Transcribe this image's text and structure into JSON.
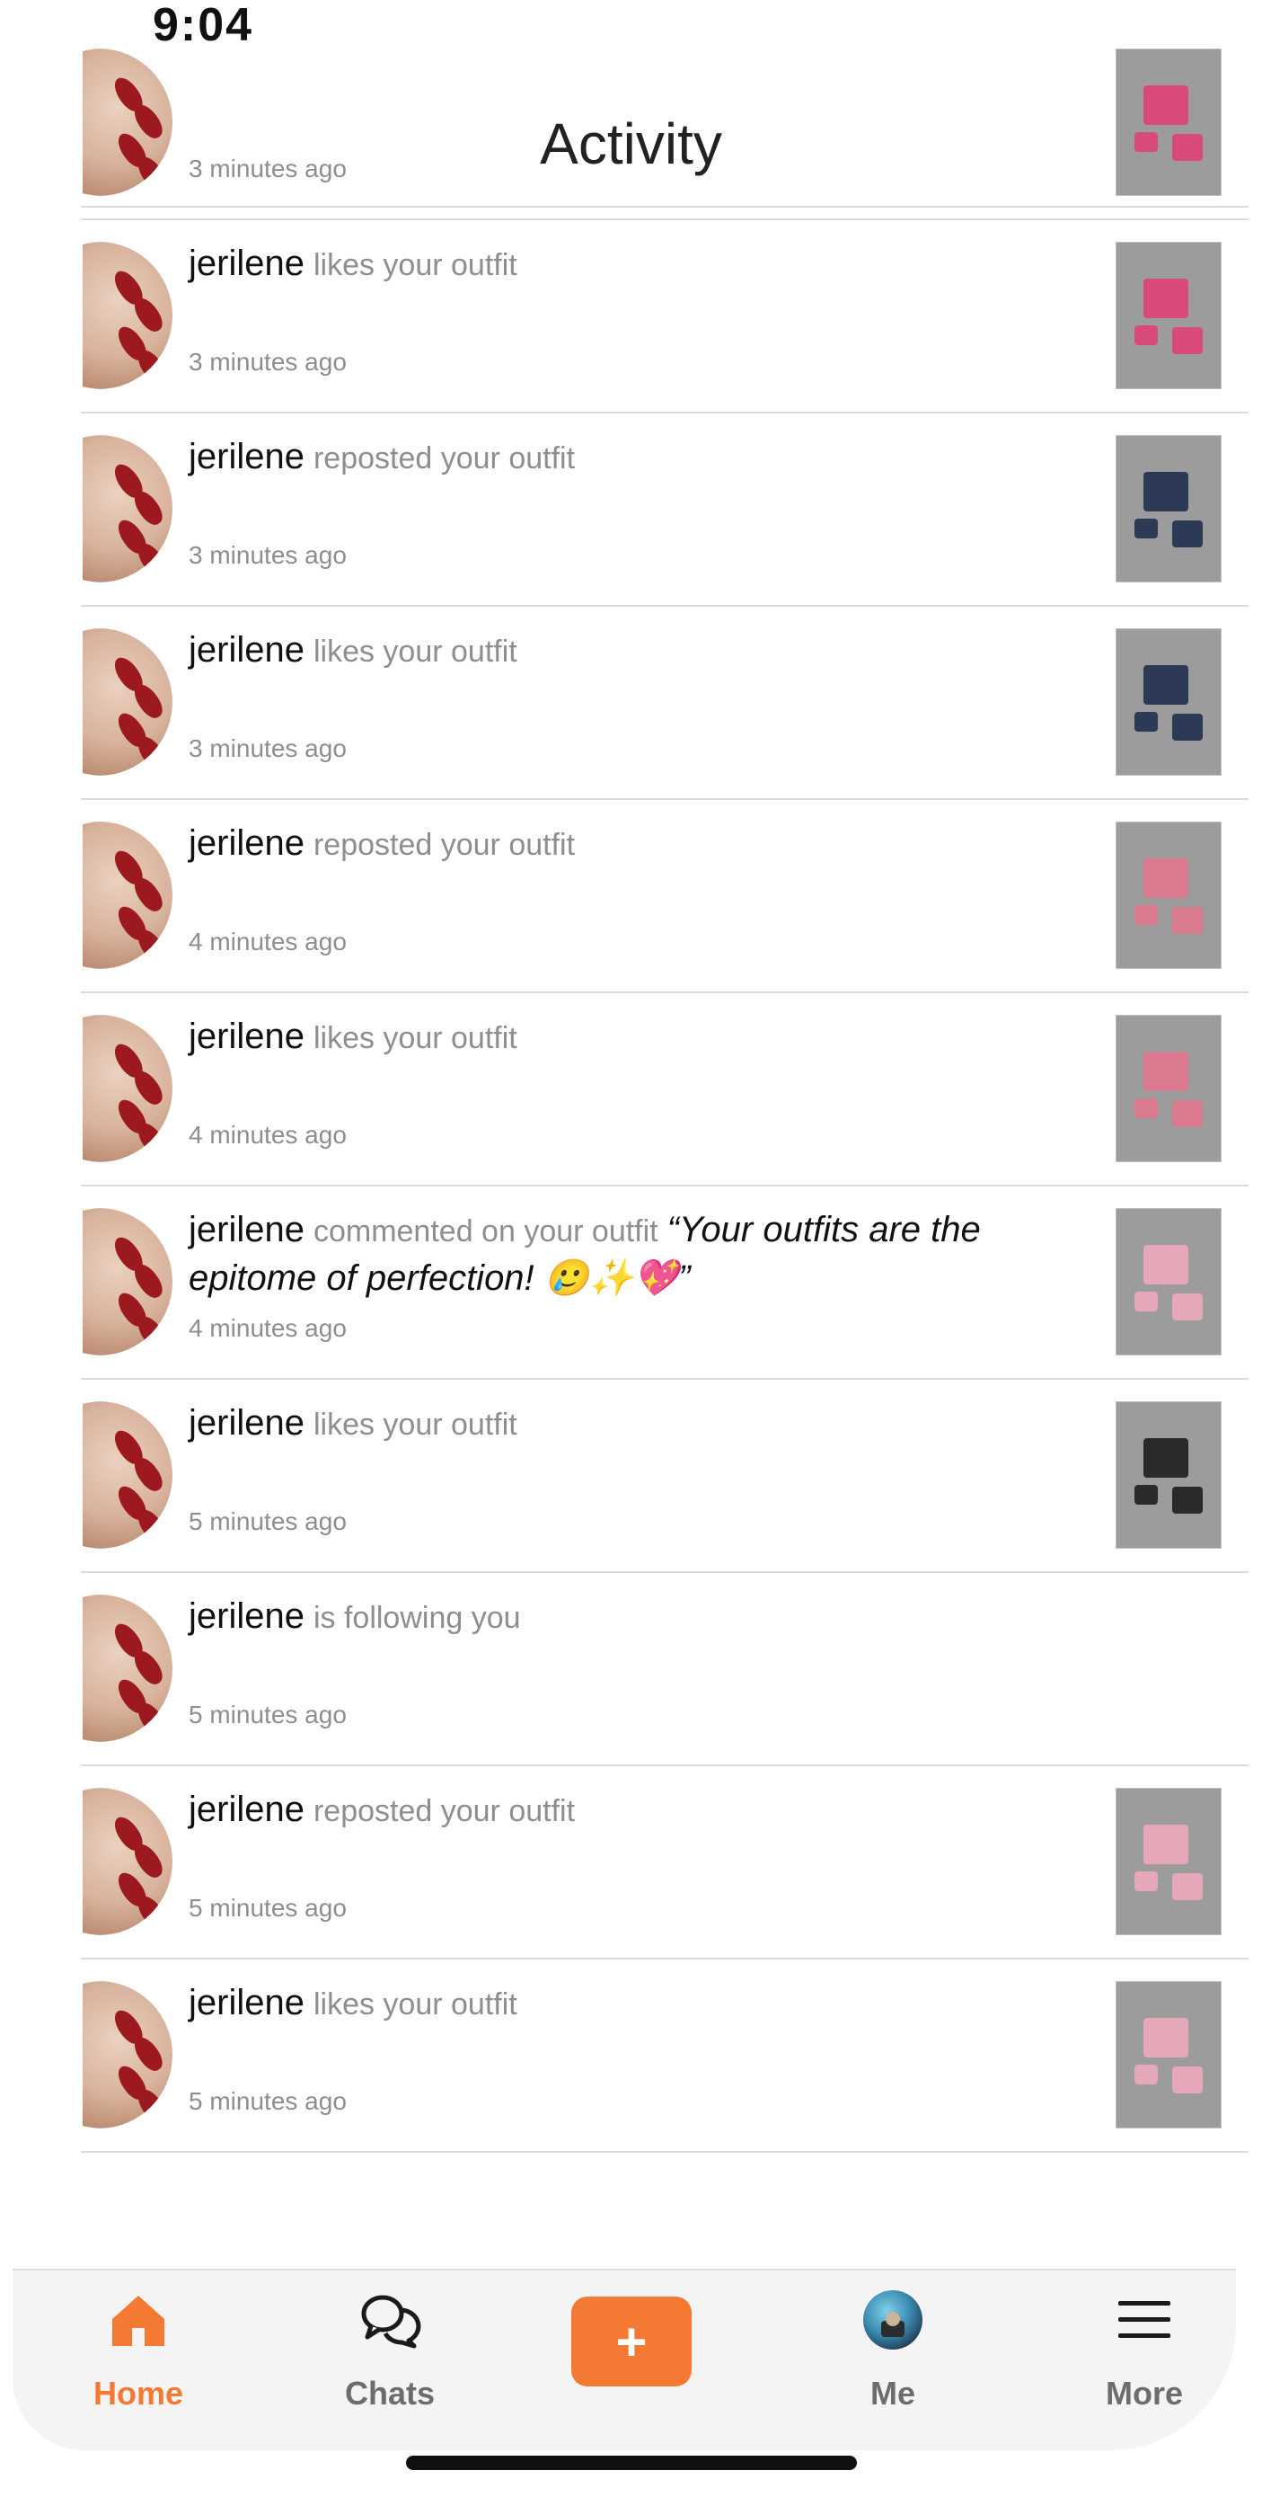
{
  "status_bar": {
    "time": "9:04"
  },
  "header": {
    "title": "Activity"
  },
  "activities": [
    {
      "user": "",
      "action": "",
      "comment": "",
      "time": "3 minutes ago",
      "has_thumb": true,
      "thumb_color": "#d84a7b"
    },
    {
      "user": "jerilene",
      "action": "likes your outfit",
      "comment": "",
      "time": "3 minutes ago",
      "has_thumb": true,
      "thumb_color": "#d84a7b"
    },
    {
      "user": "jerilene",
      "action": "reposted your outfit",
      "comment": "",
      "time": "3 minutes ago",
      "has_thumb": true,
      "thumb_color": "#2d3a55"
    },
    {
      "user": "jerilene",
      "action": "likes your outfit",
      "comment": "",
      "time": "3 minutes ago",
      "has_thumb": true,
      "thumb_color": "#2d3a55"
    },
    {
      "user": "jerilene",
      "action": "reposted your outfit",
      "comment": "",
      "time": "4 minutes ago",
      "has_thumb": true,
      "thumb_color": "#d97a8e"
    },
    {
      "user": "jerilene",
      "action": "likes your outfit",
      "comment": "",
      "time": "4 minutes ago",
      "has_thumb": true,
      "thumb_color": "#d97a8e"
    },
    {
      "user": "jerilene",
      "action": "commented on your outfit",
      "comment": "“Your outfits are the epitome of perfection! 🥲✨💖”",
      "time": "4 minutes ago",
      "has_thumb": true,
      "thumb_color": "#e4a8b8"
    },
    {
      "user": "jerilene",
      "action": "likes your outfit",
      "comment": "",
      "time": "5 minutes ago",
      "has_thumb": true,
      "thumb_color": "#2a2a2a"
    },
    {
      "user": "jerilene",
      "action": "is following you",
      "comment": "",
      "time": "5 minutes ago",
      "has_thumb": false,
      "thumb_color": ""
    },
    {
      "user": "jerilene",
      "action": "reposted your outfit",
      "comment": "",
      "time": "5 minutes ago",
      "has_thumb": true,
      "thumb_color": "#e4a8b8"
    },
    {
      "user": "jerilene",
      "action": "likes your outfit",
      "comment": "",
      "time": "5 minutes ago",
      "has_thumb": true,
      "thumb_color": "#e4a8b8"
    }
  ],
  "tab_bar": {
    "home": "Home",
    "chats": "Chats",
    "add": "+",
    "me": "Me",
    "more": "More"
  },
  "colors": {
    "accent": "#f47a33",
    "muted_text": "#8e8e8e",
    "divider": "#d9d9d9"
  }
}
